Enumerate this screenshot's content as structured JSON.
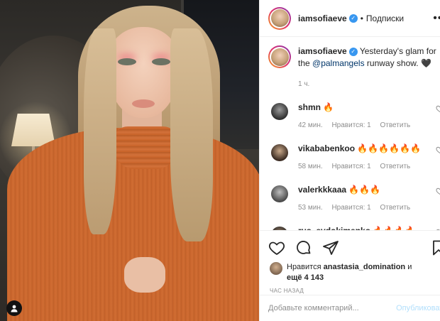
{
  "post": {
    "author": "iamsofiaeve",
    "follow_label": "Подписки",
    "more_label": "•••"
  },
  "caption": {
    "username": "iamsofiaeve",
    "text_before": "Yesterday's glam for the ",
    "mention": "@palmangels",
    "text_after": " runway show. 🖤",
    "time": "1 ч."
  },
  "comments": [
    {
      "username": "shmn",
      "text": "🔥",
      "time": "42 мин.",
      "likes": "Нравится: 1",
      "reply": "Ответить",
      "avatar_color": "#2f2f2f"
    },
    {
      "username": "vikababenkoo",
      "text": "🔥🔥🔥🔥🔥🔥",
      "time": "58 мин.",
      "likes": "Нравится: 1",
      "reply": "Ответить",
      "avatar_color": "#3a2b22"
    },
    {
      "username": "valerkkkaaa",
      "text": "🔥🔥🔥",
      "time": "53 мин.",
      "likes": "Нравится: 1",
      "reply": "Ответить",
      "avatar_color": "#4a4a4a"
    },
    {
      "username": "rus_evdokimenko",
      "text": "🔥🔥🔥🔥",
      "time": "",
      "likes": "",
      "reply": "",
      "avatar_color": "#1e1e1e"
    }
  ],
  "likes": {
    "prefix": "Нравится",
    "user": "anastasia_domination",
    "joiner": "и",
    "more": "ещё 4 143"
  },
  "timeago": "час назад",
  "add_comment": {
    "placeholder": "Добавьте комментарий...",
    "post_label": "Опубликовать"
  },
  "icons": {
    "verified": "verified-badge-icon",
    "like": "heart-icon",
    "comment": "comment-bubble-icon",
    "share": "paper-plane-icon",
    "save": "bookmark-icon",
    "tag": "user-tag-icon"
  },
  "colors": {
    "verified": "#3897f0",
    "muted": "#8e8e8e",
    "link": "#003569",
    "post_disabled": "#b2dffc"
  }
}
